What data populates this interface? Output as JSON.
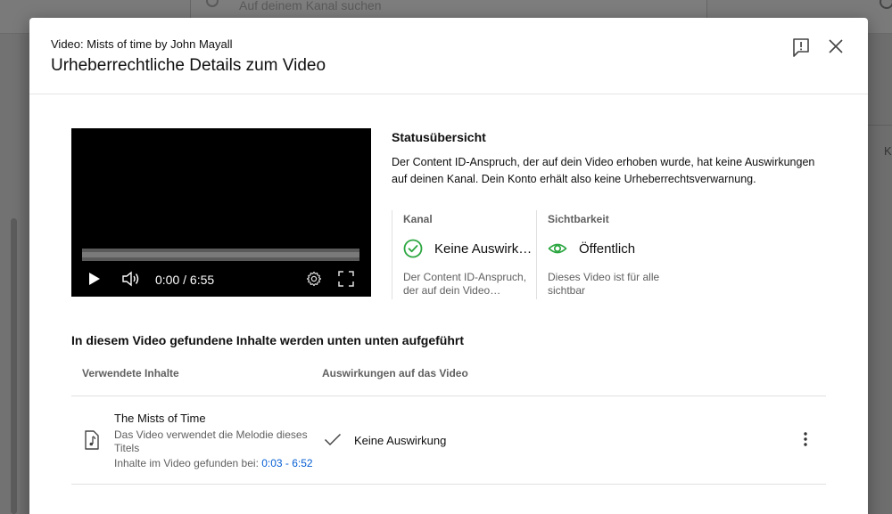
{
  "background": {
    "search_placeholder": "Auf deinem Kanal suchen",
    "right_text": "K"
  },
  "dialog": {
    "subtitle": "Video: Mists of time by John Mayall",
    "title": "Urheberrechtliche Details zum Video",
    "feedback_icon": "feedback-icon",
    "close_icon": "close-icon"
  },
  "player": {
    "time": "0:00 / 6:55",
    "progress": 0
  },
  "status": {
    "title": "Statusübersicht",
    "description": "Der Content ID-Anspruch, der auf dein Video erhoben wurde, hat keine Auswirkungen auf deinen Kanal. Dein Konto erhält also keine Urheberrechtsverwarnung.",
    "channel": {
      "label": "Kanal",
      "value": "Keine Auswirk…",
      "description": "Der Content ID-Anspruch, der auf dein Video…",
      "icon": "check-circle-icon"
    },
    "visibility": {
      "label": "Sichtbarkeit",
      "value": "Öffentlich",
      "description": "Dieses Video ist für alle sichtbar",
      "icon": "eye-icon"
    }
  },
  "content": {
    "title": "In diesem Video gefundene Inhalte werden unten unten aufgeführt",
    "columns": [
      "Verwendete Inhalte",
      "Auswirkungen auf das Video"
    ],
    "rows": [
      {
        "title": "The Mists of Time",
        "description": "Das Video verwendet die Melodie dieses Titels",
        "found_label": "Inhalte im Video gefunden bei: ",
        "found_range": "0:03 - 6:52",
        "impact": "Keine Auswirkung"
      }
    ]
  },
  "colors": {
    "green": "#2ba640",
    "link": "#065fd4"
  }
}
